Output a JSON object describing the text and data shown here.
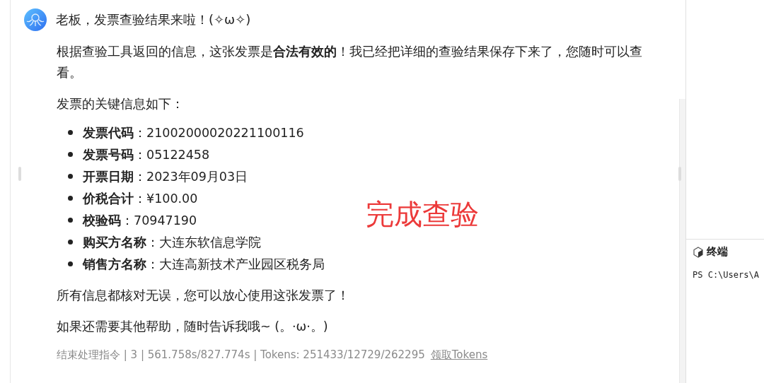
{
  "message": {
    "title": "老板，发票查验结果来啦！(✧ω✧)",
    "paragraphs": [
      "根据查验工具返回的信息，这张发票是**合法有效的**！我已经把详细的查验结果保存下来了，您随时可以查看。",
      "发票的关键信息如下："
    ],
    "fields": [
      "**发票代码**：21002000020221100116",
      "**发票号码**：05122458",
      "**开票日期**：2023年09月03日",
      "**价税合计**：¥100.00",
      "**校验码**：70947190",
      "**购买方名称**：大连东软信息学院",
      "**销售方名称**：大连高新技术产业园区税务局"
    ],
    "closing": [
      "所有信息都核对无误，您可以放心使用这张发票了！",
      "如果还需要其他帮助，随时告诉我哦~ (。·ω·。)"
    ],
    "footer": {
      "stats": "结束处理指令 | 3 | 561.758s/827.774s | Tokens: 251433/12729/262295",
      "link": "领取Tokens"
    }
  },
  "annotation": "完成查验",
  "terminal": {
    "title": "终端",
    "line": "PS C:\\Users\\A"
  }
}
